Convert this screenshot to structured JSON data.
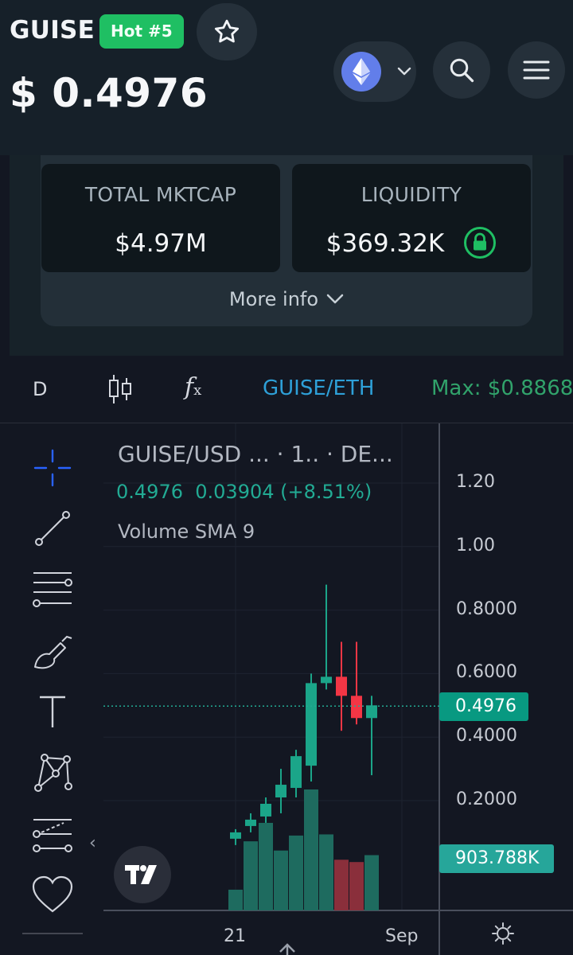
{
  "header": {
    "symbol": "GUISE",
    "hot_badge": "Hot #5",
    "price": "$ 0.4976",
    "favorite_icon": "star-outline-icon",
    "chain_icon": "ethereum-icon",
    "search_icon": "search-icon",
    "menu_icon": "hamburger-menu-icon"
  },
  "stats": {
    "market_cap": {
      "label": "TOTAL MKTCAP",
      "value": "$4.97M"
    },
    "liquidity": {
      "label": "LIQUIDITY",
      "value": "$369.32K",
      "status_icon": "lock-icon"
    },
    "more_info": "More info"
  },
  "toolbar": {
    "interval": "D",
    "pair": "GUISE/ETH",
    "max": "Max: $0.8868"
  },
  "chart_legend": {
    "title": "GUISE/USD ... · 1.. · DE...",
    "last": "0.4976",
    "change": "0.03904",
    "change_pct": "(+8.51%)",
    "volume_study": "Volume SMA 9"
  },
  "price_tag": "0.4976",
  "volume_tag": "903.788K",
  "colors": {
    "up": "#089981",
    "down": "#f23645",
    "vol_up": "#1e6b5f",
    "vol_down": "#8a2f3b",
    "accent_green": "#1fbf63",
    "pair_blue": "#2ea0d8"
  },
  "chart_data": {
    "type": "candlestick",
    "title": "GUISE/USD ... · 1.. · DE...",
    "y_tick_labels": [
      "1.20",
      "1.00",
      "0.8000",
      "0.6000",
      "0.4000",
      "0.2000"
    ],
    "y_ticks": [
      1.2,
      1.0,
      0.8,
      0.6,
      0.4,
      0.2
    ],
    "ylim": [
      0.0,
      1.34
    ],
    "x_tick_labels": [
      "21",
      "Sep"
    ],
    "last_price": 0.4976,
    "candles": [
      {
        "o": 0.08,
        "h": 0.11,
        "l": 0.06,
        "c": 0.1,
        "v": 180
      },
      {
        "o": 0.12,
        "h": 0.16,
        "l": 0.1,
        "c": 0.14,
        "v": 600
      },
      {
        "o": 0.15,
        "h": 0.21,
        "l": 0.13,
        "c": 0.19,
        "v": 760
      },
      {
        "o": 0.21,
        "h": 0.3,
        "l": 0.16,
        "c": 0.25,
        "v": 520
      },
      {
        "o": 0.24,
        "h": 0.36,
        "l": 0.21,
        "c": 0.34,
        "v": 650
      },
      {
        "o": 0.31,
        "h": 0.6,
        "l": 0.26,
        "c": 0.57,
        "v": 1050
      },
      {
        "o": 0.57,
        "h": 0.88,
        "l": 0.55,
        "c": 0.59,
        "v": 660
      },
      {
        "o": 0.59,
        "h": 0.7,
        "l": 0.42,
        "c": 0.53,
        "v": 440
      },
      {
        "o": 0.53,
        "h": 0.7,
        "l": 0.44,
        "c": 0.46,
        "v": 420
      },
      {
        "o": 0.46,
        "h": 0.53,
        "l": 0.28,
        "c": 0.5,
        "v": 480
      }
    ]
  }
}
